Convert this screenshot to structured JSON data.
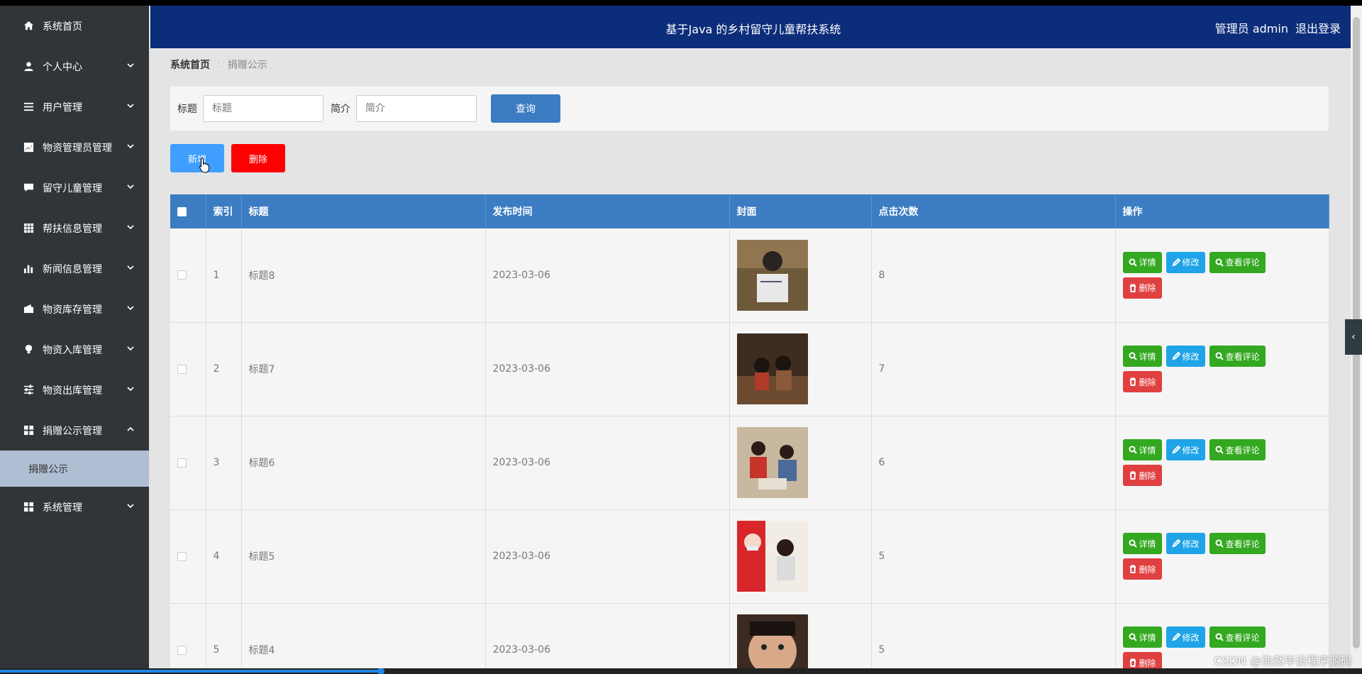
{
  "sidebar": {
    "items": [
      {
        "label": "系统首页",
        "icon": "home-icon",
        "has_chevron": false
      },
      {
        "label": "个人中心",
        "icon": "user-icon",
        "has_chevron": true
      },
      {
        "label": "用户管理",
        "icon": "list-icon",
        "has_chevron": true
      },
      {
        "label": "物资管理员管理",
        "icon": "chart-line-icon",
        "has_chevron": true
      },
      {
        "label": "留守儿童管理",
        "icon": "message-icon",
        "has_chevron": true
      },
      {
        "label": "帮扶信息管理",
        "icon": "grid-icon",
        "has_chevron": true
      },
      {
        "label": "新闻信息管理",
        "icon": "bar-chart-icon",
        "has_chevron": true
      },
      {
        "label": "物资库存管理",
        "icon": "wallet-icon",
        "has_chevron": true
      },
      {
        "label": "物资入库管理",
        "icon": "bulb-icon",
        "has_chevron": true
      },
      {
        "label": "物资出库管理",
        "icon": "sliders-icon",
        "has_chevron": true
      },
      {
        "label": "捐赠公示管理",
        "icon": "apps-icon",
        "has_chevron": true,
        "expanded": true
      },
      {
        "label": "系统管理",
        "icon": "apps-icon",
        "has_chevron": true
      }
    ],
    "submenu": {
      "label": "捐赠公示"
    }
  },
  "header": {
    "title": "基于Java 的乡村留守儿童帮扶系统",
    "user": "管理员 admin",
    "logout": "退出登录"
  },
  "breadcrumb": {
    "home": "系统首页",
    "current": "捐赠公示"
  },
  "search": {
    "title_label": "标题",
    "title_placeholder": "标题",
    "intro_label": "简介",
    "intro_placeholder": "简介",
    "query_button": "查询"
  },
  "actions": {
    "add": "新增",
    "delete": "删除"
  },
  "table": {
    "headers": [
      "",
      "索引",
      "标题",
      "发布时间",
      "封面",
      "点击次数",
      "操作"
    ],
    "rows": [
      {
        "index": "1",
        "title": "标题8",
        "date": "2023-03-06",
        "clicks": "8"
      },
      {
        "index": "2",
        "title": "标题7",
        "date": "2023-03-06",
        "clicks": "7"
      },
      {
        "index": "3",
        "title": "标题6",
        "date": "2023-03-06",
        "clicks": "6"
      },
      {
        "index": "4",
        "title": "标题5",
        "date": "2023-03-06",
        "clicks": "5"
      },
      {
        "index": "5",
        "title": "标题4",
        "date": "2023-03-06",
        "clicks": "5"
      }
    ],
    "ops": {
      "detail": "详情",
      "edit": "修改",
      "comments": "查看评论",
      "delete": "删除"
    }
  },
  "watermark": "CSDN @浩然毕设程序源码",
  "colors": {
    "sidebar": "#303539",
    "header": "#0c2d7a",
    "table_header": "#3b7cc2",
    "green": "#33a820",
    "blue": "#1fa4e8",
    "red": "#e04040"
  }
}
